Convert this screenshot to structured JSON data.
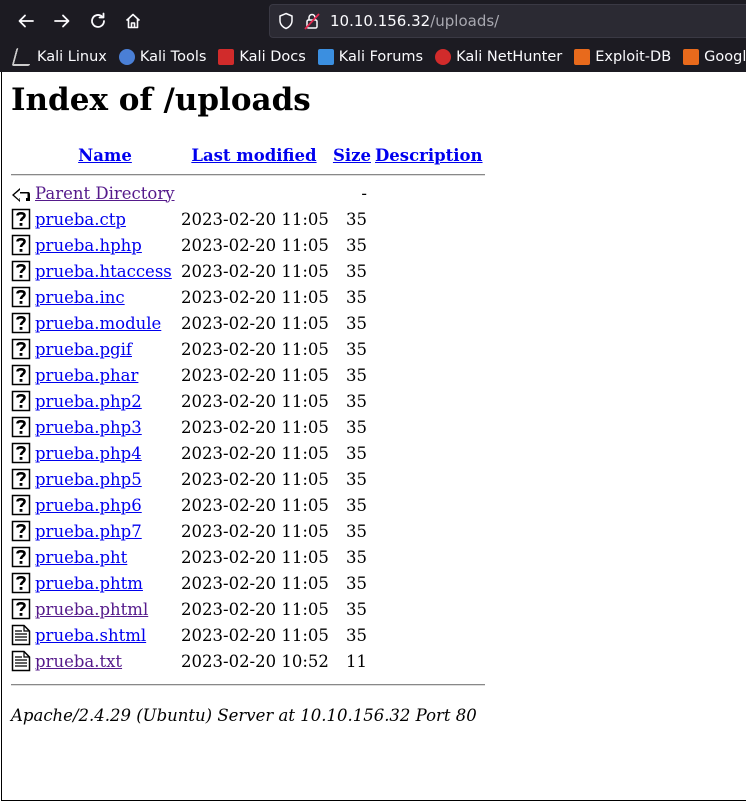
{
  "browser": {
    "url_host": "10.10.156.32",
    "url_path": "/uploads/",
    "bookmarks": [
      {
        "label": "Kali Linux",
        "icon": "kali-dragon-icon"
      },
      {
        "label": "Kali Tools",
        "icon": "kali-tools-icon"
      },
      {
        "label": "Kali Docs",
        "icon": "kali-docs-icon"
      },
      {
        "label": "Kali Forums",
        "icon": "kali-forums-icon"
      },
      {
        "label": "Kali NetHunter",
        "icon": "kali-nethunter-icon"
      },
      {
        "label": "Exploit-DB",
        "icon": "exploit-db-icon"
      },
      {
        "label": "Google Hacking",
        "icon": "google-hacking-icon"
      }
    ]
  },
  "page": {
    "title": "Index of /uploads",
    "headers": {
      "name": "Name",
      "modified": "Last modified",
      "size": "Size",
      "description": "Description"
    },
    "parent": {
      "label": "Parent Directory",
      "size": "-"
    },
    "rows": [
      {
        "name": "prueba.ctp",
        "modified": "2023-02-20 11:05",
        "size": "35",
        "icon": "unknown-file-icon",
        "visited": false
      },
      {
        "name": "prueba.hphp",
        "modified": "2023-02-20 11:05",
        "size": "35",
        "icon": "unknown-file-icon",
        "visited": false
      },
      {
        "name": "prueba.htaccess",
        "modified": "2023-02-20 11:05",
        "size": "35",
        "icon": "unknown-file-icon",
        "visited": false
      },
      {
        "name": "prueba.inc",
        "modified": "2023-02-20 11:05",
        "size": "35",
        "icon": "unknown-file-icon",
        "visited": false
      },
      {
        "name": "prueba.module",
        "modified": "2023-02-20 11:05",
        "size": "35",
        "icon": "unknown-file-icon",
        "visited": false
      },
      {
        "name": "prueba.pgif",
        "modified": "2023-02-20 11:05",
        "size": "35",
        "icon": "unknown-file-icon",
        "visited": false
      },
      {
        "name": "prueba.phar",
        "modified": "2023-02-20 11:05",
        "size": "35",
        "icon": "unknown-file-icon",
        "visited": false
      },
      {
        "name": "prueba.php2",
        "modified": "2023-02-20 11:05",
        "size": "35",
        "icon": "unknown-file-icon",
        "visited": false
      },
      {
        "name": "prueba.php3",
        "modified": "2023-02-20 11:05",
        "size": "35",
        "icon": "unknown-file-icon",
        "visited": false
      },
      {
        "name": "prueba.php4",
        "modified": "2023-02-20 11:05",
        "size": "35",
        "icon": "unknown-file-icon",
        "visited": false
      },
      {
        "name": "prueba.php5",
        "modified": "2023-02-20 11:05",
        "size": "35",
        "icon": "unknown-file-icon",
        "visited": false
      },
      {
        "name": "prueba.php6",
        "modified": "2023-02-20 11:05",
        "size": "35",
        "icon": "unknown-file-icon",
        "visited": false
      },
      {
        "name": "prueba.php7",
        "modified": "2023-02-20 11:05",
        "size": "35",
        "icon": "unknown-file-icon",
        "visited": false
      },
      {
        "name": "prueba.pht",
        "modified": "2023-02-20 11:05",
        "size": "35",
        "icon": "unknown-file-icon",
        "visited": false
      },
      {
        "name": "prueba.phtm",
        "modified": "2023-02-20 11:05",
        "size": "35",
        "icon": "unknown-file-icon",
        "visited": false
      },
      {
        "name": "prueba.phtml",
        "modified": "2023-02-20 11:05",
        "size": "35",
        "icon": "unknown-file-icon",
        "visited": true
      },
      {
        "name": "prueba.shtml",
        "modified": "2023-02-20 11:05",
        "size": "35",
        "icon": "text-file-icon",
        "visited": false
      },
      {
        "name": "prueba.txt",
        "modified": "2023-02-20 10:52",
        "size": "11",
        "icon": "text-file-icon",
        "visited": true
      }
    ],
    "footer": "Apache/2.4.29 (Ubuntu) Server at 10.10.156.32 Port 80"
  }
}
